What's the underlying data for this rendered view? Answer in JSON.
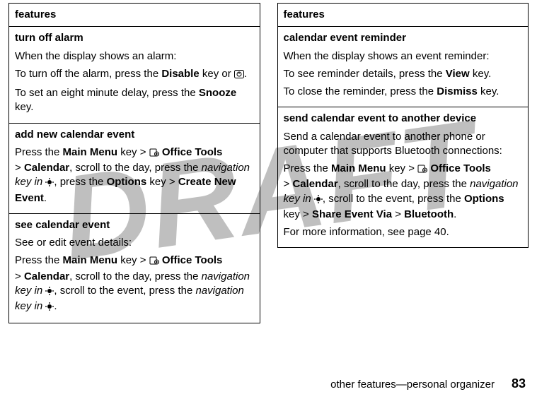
{
  "watermark": "DRAFT",
  "footer": {
    "section": "other features—personal organizer",
    "page": "83"
  },
  "common": {
    "main_menu_key": "Main Menu",
    "office_tools": "Office Tools",
    "calendar": "Calendar",
    "options_key": "Options",
    "nav_key_in_phrase": "navigation key in"
  },
  "left": {
    "header": "features",
    "cells": [
      {
        "title": "turn off alarm",
        "lines": {
          "intro": "When the display shows an alarm:",
          "turn_off_pre": "To turn off the alarm, press the ",
          "disable_key": "Disable",
          "turn_off_post": " key or ",
          "turn_off_end": ".",
          "delay_pre": "To set an eight minute delay, press the ",
          "snooze_key": "Snooze",
          "delay_post": " key."
        }
      },
      {
        "title": "add new calendar event",
        "lines": {
          "p1_pre": "Press the ",
          "p1_key_post": " key > ",
          "p2_scroll": ", scroll to the day, press the ",
          "p3_press": ", press the ",
          "p3_key_post": " key > ",
          "create_new": "Create New Event",
          "end": "."
        }
      },
      {
        "title": "see calendar event",
        "lines": {
          "intro": "See or edit event details:",
          "p1_pre": "Press the ",
          "p1_key_post": " key > ",
          "p2_scroll": ", scroll to the day, press the ",
          "p3_scroll_event": ", scroll to the event, press the ",
          "end": "."
        }
      }
    ]
  },
  "right": {
    "header": "features",
    "cells": [
      {
        "title": "calendar event reminder",
        "lines": {
          "intro": "When the display shows an event reminder:",
          "see_pre": "To see reminder details, press the ",
          "view_key": "View",
          "see_post": " key.",
          "close_pre": "To close the reminder, press the ",
          "dismiss_key": "Dismiss",
          "close_post": " key."
        }
      },
      {
        "title": "send calendar event to another device",
        "lines": {
          "intro": "Send a calendar event to another phone or computer that supports Bluetooth connections:",
          "p1_pre": "Press the ",
          "p1_key_post": " key > ",
          "p2_scroll": ", scroll to the day, press the ",
          "p3_scroll_event": ", scroll to the event, press the ",
          "p3_key_post": " key > ",
          "share_via": "Share Event Via",
          "bt": "Bluetooth",
          "end": ".",
          "more_info": "For more information, see page 40."
        }
      }
    ]
  }
}
